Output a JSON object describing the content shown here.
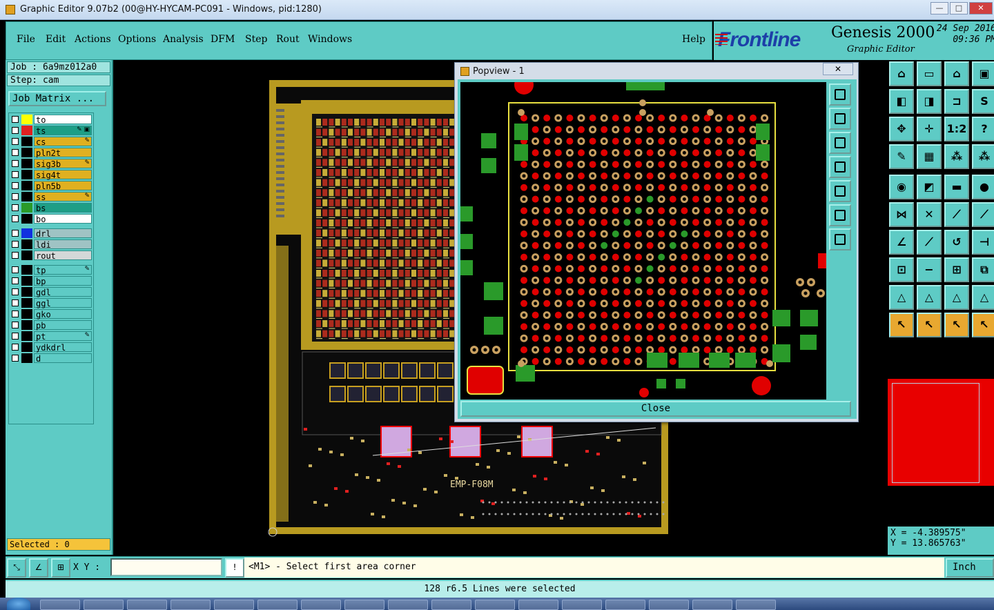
{
  "window": {
    "title": "Graphic Editor 9.07b2 (00@HY-HYCAM-PC091 - Windows, pid:1280)",
    "controls": [
      "—",
      "□",
      "✕"
    ]
  },
  "menu": [
    "File",
    "Edit",
    "Actions",
    "Options",
    "Analysis",
    "DFM",
    "Step",
    "Rout",
    "Windows"
  ],
  "help": "Help",
  "brand": {
    "logo": "Frontline",
    "product": "Genesis 2000",
    "subtitle": "Graphic Editor",
    "date": "24 Sep 2016",
    "time": "09:36 PM"
  },
  "job": {
    "job": "Job : 6a9mz012a0",
    "step": "Step: cam",
    "matrix_button": "Job Matrix ..."
  },
  "layers": [
    {
      "name": "to",
      "swatch": "#ffff00",
      "bg": "#ffffff",
      "mark": ""
    },
    {
      "name": "ts",
      "swatch": "#e02020",
      "bg": "#1e9e86",
      "mark": "✎ ▣"
    },
    {
      "name": "cs",
      "swatch": "#000000",
      "bg": "#e0b020",
      "mark": "✎"
    },
    {
      "name": "pln2t",
      "swatch": "#000000",
      "bg": "#e0b020",
      "mark": ""
    },
    {
      "name": "sig3b",
      "swatch": "#000000",
      "bg": "#e0b020",
      "mark": "✎"
    },
    {
      "name": "sig4t",
      "swatch": "#000000",
      "bg": "#e0b020",
      "mark": ""
    },
    {
      "name": "pln5b",
      "swatch": "#000000",
      "bg": "#e0b020",
      "mark": ""
    },
    {
      "name": "ss",
      "swatch": "#000000",
      "bg": "#e0b020",
      "mark": "✎"
    },
    {
      "name": "bs",
      "swatch": "#2a9a2a",
      "bg": "#1e9e86",
      "mark": ""
    },
    {
      "name": "bo",
      "swatch": "#000000",
      "bg": "#ffffff",
      "mark": ""
    },
    {
      "name": "drl",
      "swatch": "#1030e0",
      "bg": "#9fc3c4",
      "mark": ""
    },
    {
      "name": "ldi",
      "swatch": "#000000",
      "bg": "#9fc3c4",
      "mark": ""
    },
    {
      "name": "rout",
      "swatch": "#000000",
      "bg": "#d4d8d8",
      "mark": ""
    },
    {
      "name": "tp",
      "swatch": "#000000",
      "bg": "#5ecbc5",
      "mark": "✎"
    },
    {
      "name": "bp",
      "swatch": "#000000",
      "bg": "#5ecbc5",
      "mark": ""
    },
    {
      "name": "gdl",
      "swatch": "#000000",
      "bg": "#5ecbc5",
      "mark": ""
    },
    {
      "name": "ggl",
      "swatch": "#000000",
      "bg": "#5ecbc5",
      "mark": ""
    },
    {
      "name": "gko",
      "swatch": "#000000",
      "bg": "#5ecbc5",
      "mark": ""
    },
    {
      "name": "pb",
      "swatch": "#000000",
      "bg": "#5ecbc5",
      "mark": ""
    },
    {
      "name": "pt",
      "swatch": "#000000",
      "bg": "#5ecbc5",
      "mark": "✎"
    },
    {
      "name": "ydkdrl",
      "swatch": "#000000",
      "bg": "#5ecbc5",
      "mark": ""
    },
    {
      "name": "d",
      "swatch": "#000000",
      "bg": "#5ecbc5",
      "mark": ""
    }
  ],
  "selected": "Selected : 0",
  "board": {
    "label": "EMP-F08M"
  },
  "popview": {
    "title": "Popview - 1",
    "close_x": "✕",
    "close_button": "Close"
  },
  "coords": {
    "x": "X = -4.389575\"",
    "y": "Y = 13.865763\""
  },
  "command": {
    "xy_label": "X Y :",
    "xy_value": "",
    "prompt": "<M1> - Select first area corner",
    "unit": "Inch",
    "excl": "!"
  },
  "status": "128 r6.5 Lines were selected",
  "colors": {
    "panel": "#5ecbc5",
    "gold": "#c8a020",
    "pad_red": "#e00000",
    "pad_green": "#2a9a2a",
    "bga_ring": "#c8a060"
  },
  "icons": [
    "layout-icon",
    "zoom-icon",
    "snap-icon",
    "select-pointer-icon",
    "cross-icon",
    "move-icon"
  ]
}
